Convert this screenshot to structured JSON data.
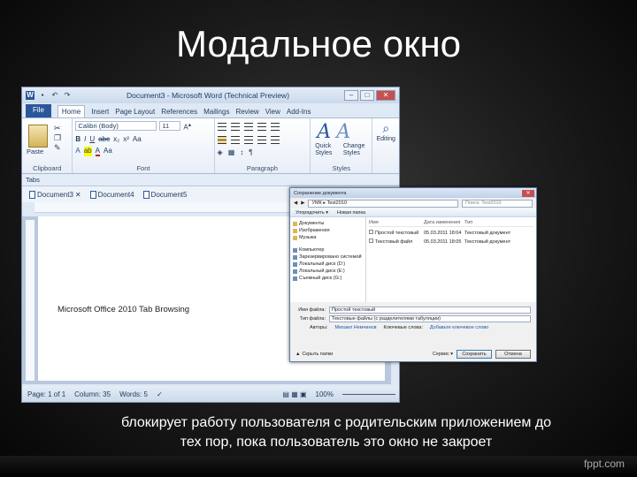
{
  "slide": {
    "title": "Модальное окно",
    "caption_line1": "блокирует работу пользователя с родительским приложением до",
    "caption_line2": "тех пор, пока пользователь это окно не закроет",
    "brand": "fppt.com"
  },
  "word": {
    "window_title": "Document3 - Microsoft Word (Technical Preview)",
    "tabs": [
      "File",
      "Home",
      "Insert",
      "Page Layout",
      "References",
      "Mailings",
      "Review",
      "View",
      "Add-Ins"
    ],
    "active_tab": "Home",
    "ribbon": {
      "paste_label": "Paste",
      "font_name": "Calibri (Body)",
      "font_size": "11",
      "style_quick": "Quick Styles",
      "style_change": "Change Styles",
      "editing": "Editing",
      "groups": [
        "Clipboard",
        "Font",
        "Paragraph",
        "Styles"
      ]
    },
    "tabs_bar_label": "Tabs",
    "doc_tabs": [
      "Document3",
      "Document4",
      "Document5"
    ],
    "page_text": "Microsoft Office 2010 Tab Browsing",
    "status": {
      "page": "Page: 1 of 1",
      "column": "Column: 35",
      "words": "Words: 5",
      "zoom": "100%"
    }
  },
  "dialog": {
    "title": "Сохранение документа",
    "address": "УМК  ▸  Test2010",
    "search_placeholder": "Поиск: Test2010",
    "toolbar": [
      "Упорядочить ▾",
      "Новая папка"
    ],
    "nav": [
      {
        "label": "Документы",
        "icon": "folder-icon"
      },
      {
        "label": "Изображения",
        "icon": "folder-icon"
      },
      {
        "label": "Музыка",
        "icon": "folder-icon"
      },
      {
        "label": "Компьютер",
        "icon": "computer-icon"
      },
      {
        "label": "Зарезервировано системой",
        "icon": "drive-icon"
      },
      {
        "label": "Локальный диск (D:)",
        "icon": "drive-icon"
      },
      {
        "label": "Локальный диск (E:)",
        "icon": "drive-icon"
      },
      {
        "label": "Съемный диск (G:)",
        "icon": "drive-icon"
      }
    ],
    "file_headers": [
      "Имя",
      "Дата изменения",
      "Тип"
    ],
    "files": [
      {
        "name": "Простой текстовый",
        "date": "05.03.2011 18:04",
        "type": "Текстовый документ"
      },
      {
        "name": "Текстовый файл",
        "date": "05.03.2011 18:05",
        "type": "Текстовый документ"
      }
    ],
    "filename_label": "Имя файла:",
    "filename_value": "Простой текстовый",
    "filetype_label": "Тип файла:",
    "filetype_value": "Текстовые файлы (с разделителями табуляции)",
    "authors_label": "Авторы:",
    "authors_value": "Михаил Немчинов",
    "tags_label": "Ключевые слова:",
    "tags_value": "Добавьте ключевое слово",
    "hide_folders": "Скрыть папки",
    "service": "Сервис ▾",
    "save_button": "Сохранить",
    "cancel_button": "Отмена"
  }
}
